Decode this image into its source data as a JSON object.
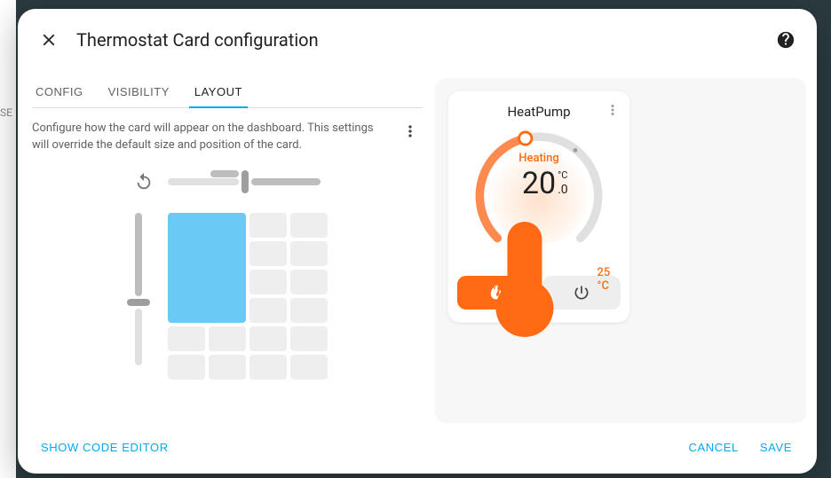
{
  "dialog": {
    "title": "Thermostat Card configuration"
  },
  "tabs": {
    "config": "CONFIG",
    "visibility": "VISIBILITY",
    "layout": "LAYOUT"
  },
  "layout_desc": "Configure how the card will appear on the dashboard. This settings will override the default size and position of the card.",
  "thermo": {
    "name": "HeatPump",
    "status": "Heating",
    "target_int": "20",
    "target_unit": "°C",
    "target_dec": ".0",
    "current": "25 °C"
  },
  "footer": {
    "code_editor": "SHOW CODE EDITOR",
    "cancel": "CANCEL",
    "save": "SAVE"
  }
}
